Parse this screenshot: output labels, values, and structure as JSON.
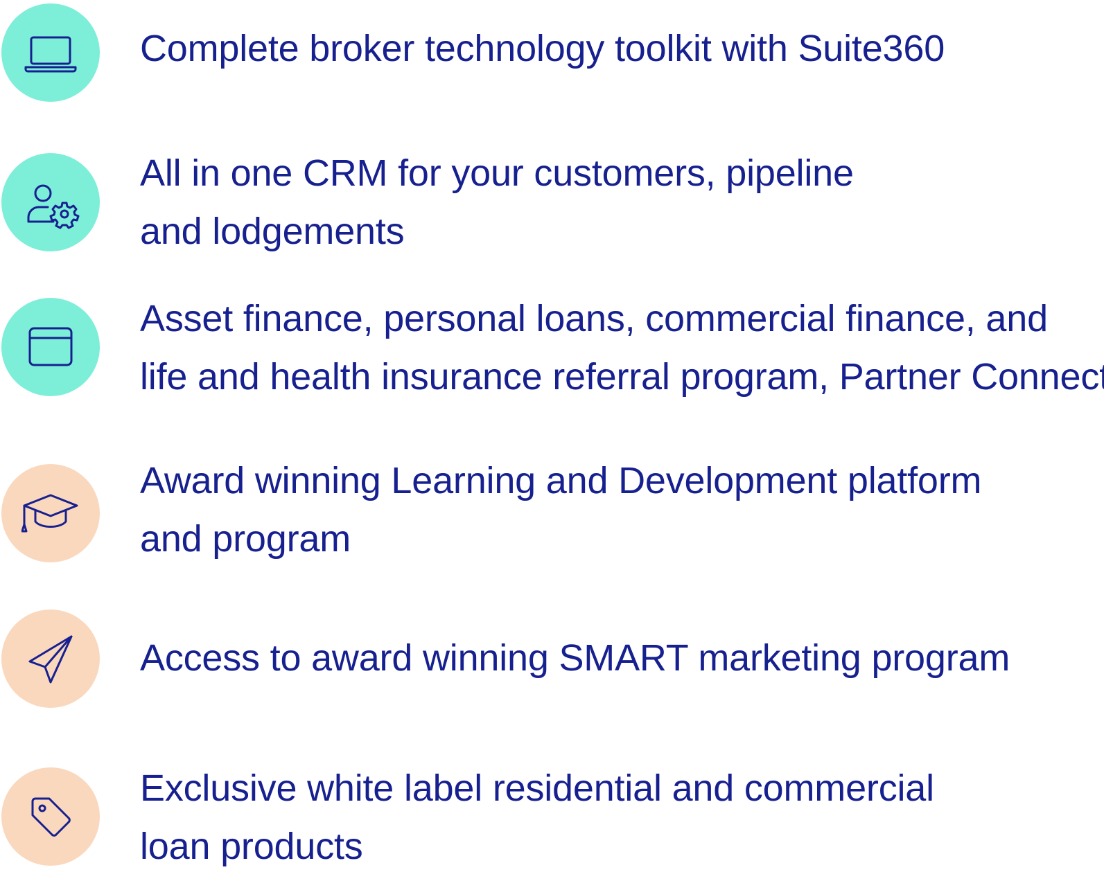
{
  "colors": {
    "text": "#17208f",
    "teal": "#7deed8",
    "peach": "#fad8bd",
    "icon_stroke": "#17208f"
  },
  "features": [
    {
      "icon": "laptop-icon",
      "circle_color": "teal",
      "lines": [
        "Complete broker technology toolkit with Suite360"
      ]
    },
    {
      "icon": "user-settings-icon",
      "circle_color": "teal",
      "lines": [
        "All in one CRM for your customers, pipeline",
        "and lodgements"
      ]
    },
    {
      "icon": "browser-window-icon",
      "circle_color": "teal",
      "lines": [
        "Asset finance, personal loans, commercial finance, and",
        "life and health insurance referral program, Partner Connect"
      ]
    },
    {
      "icon": "graduation-cap-icon",
      "circle_color": "peach",
      "lines": [
        "Award winning Learning and Development platform",
        "and program"
      ]
    },
    {
      "icon": "paper-plane-icon",
      "circle_color": "peach",
      "lines": [
        "Access to award winning SMART marketing program"
      ]
    },
    {
      "icon": "tag-icon",
      "circle_color": "peach",
      "lines": [
        "Exclusive white label residential and commercial",
        "loan products"
      ]
    }
  ]
}
